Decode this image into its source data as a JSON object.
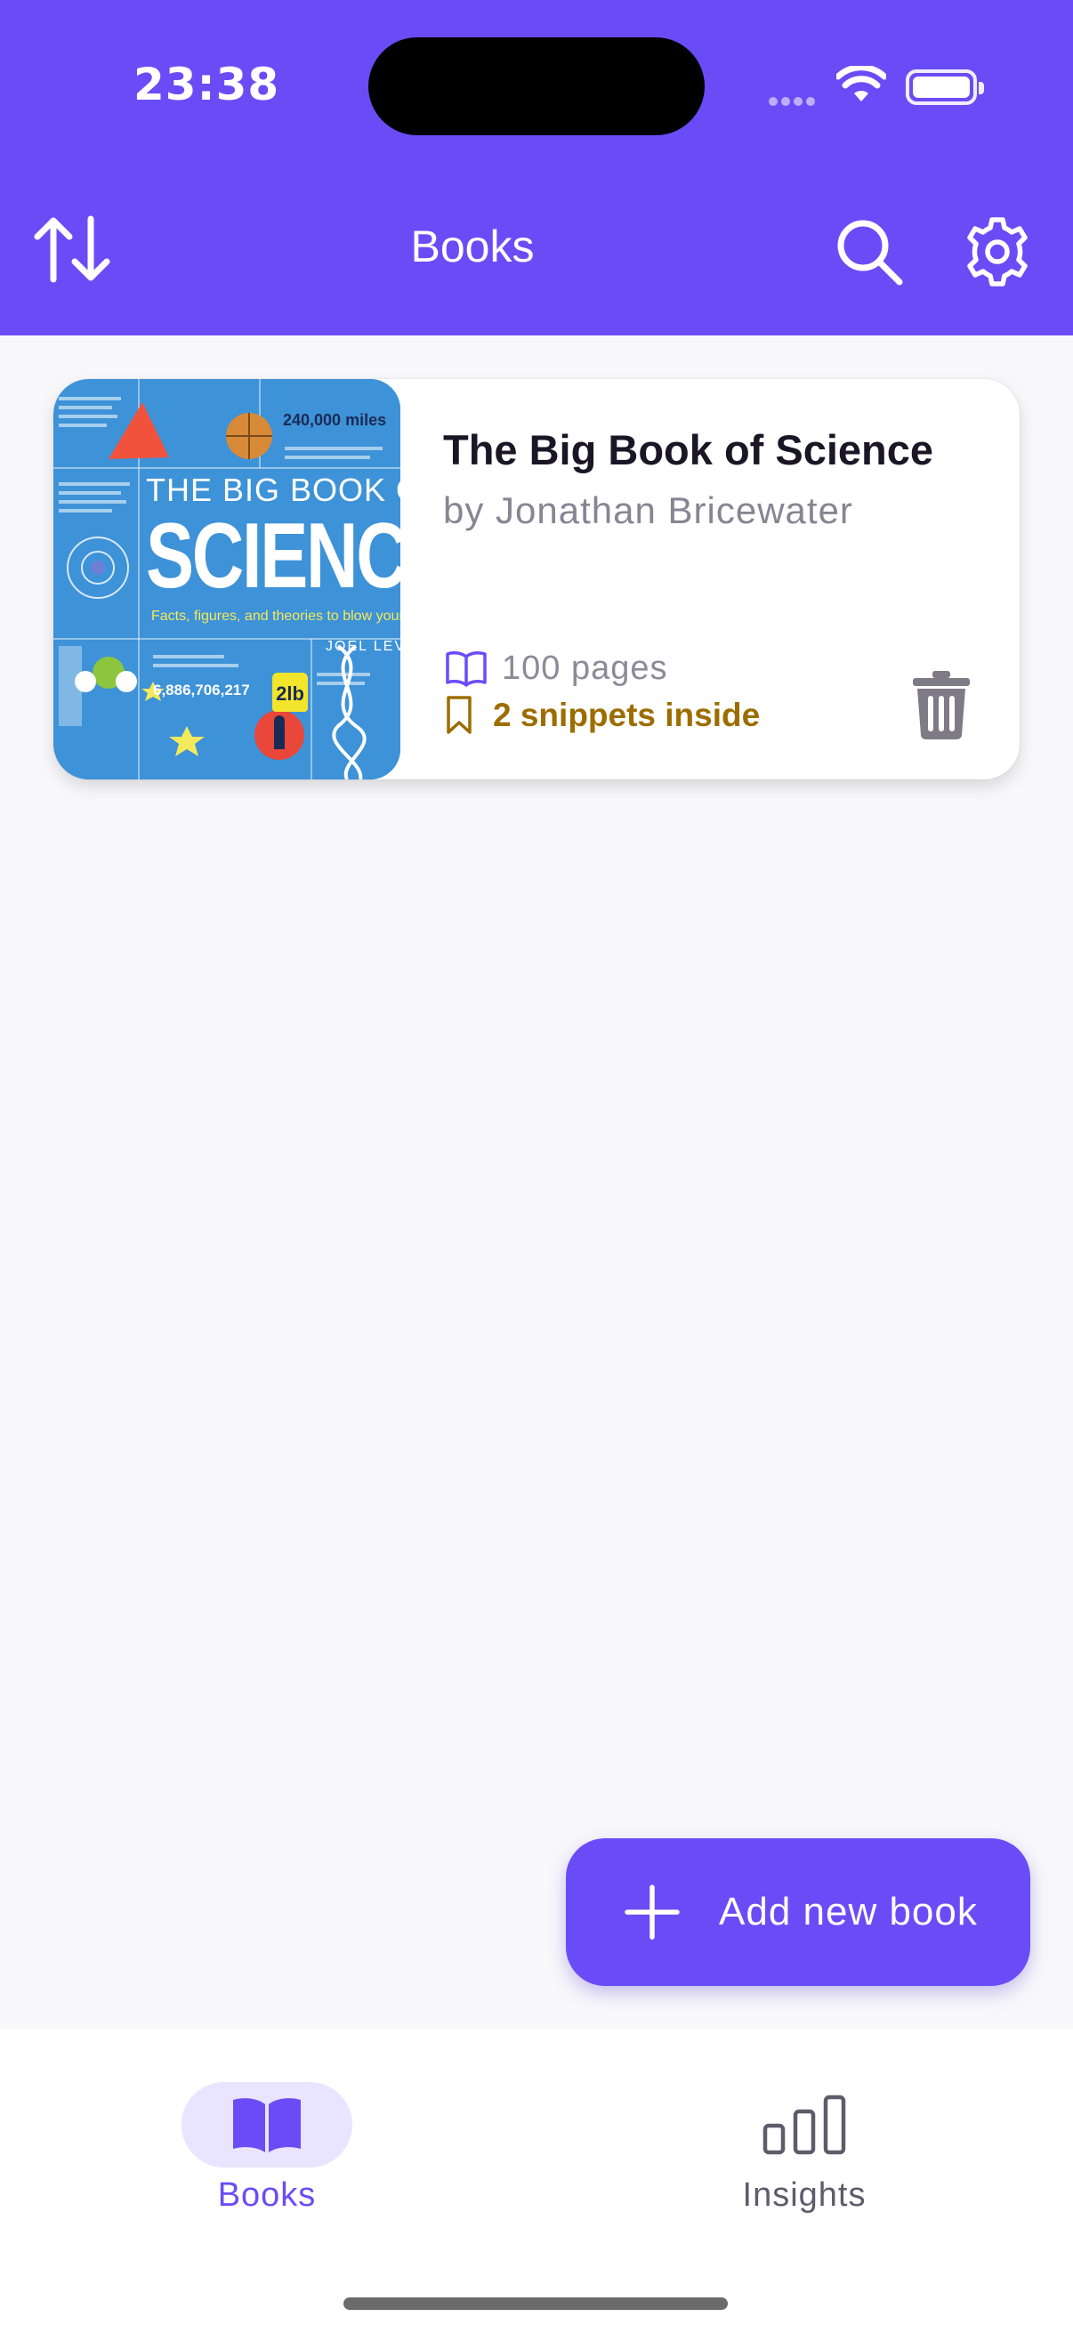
{
  "status_bar": {
    "time": "23:38"
  },
  "header": {
    "title": "Books",
    "sort_icon": "sort-arrows-icon",
    "search_icon": "search-icon",
    "settings_icon": "gear-icon",
    "background": "#6a4cf7"
  },
  "books": [
    {
      "title": "The Big Book of Science",
      "author": "by Jonathan Bricewater",
      "pages": "100 pages",
      "snippets": "2 snippets inside",
      "cover": {
        "line1": "THE BIG BOOK OF",
        "line2": "SCIENCE",
        "tagline": "Facts, figures, and theories to blow your mind",
        "author": "JOEL LEVY",
        "number": "6,886,706,217",
        "miles": "240,000 miles",
        "weight": "2lb"
      }
    }
  ],
  "fab": {
    "label": "Add new book"
  },
  "tabbar": {
    "books_label": "Books",
    "insights_label": "Insights"
  },
  "colors": {
    "accent": "#6a4cf7",
    "snippet": "#9d6d00",
    "muted": "#888593"
  }
}
